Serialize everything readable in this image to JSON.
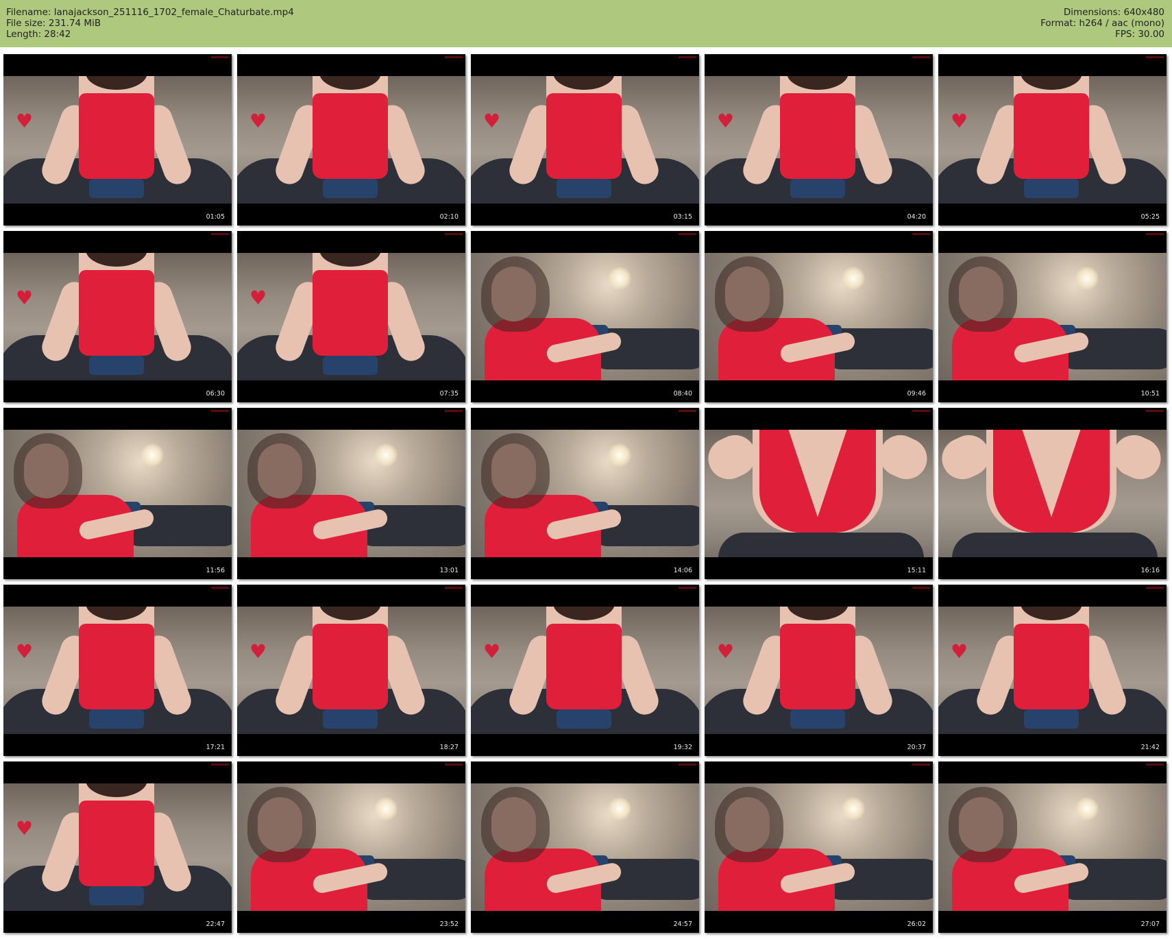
{
  "header": {
    "filename": "Filename: lanajackson_251116_1702_female_Chaturbate.mp4",
    "filesize": "File size: 231.74 MiB",
    "length": "Length: 28:42",
    "dimensions": "Dimensions: 640x480",
    "format": "Format: h264 / aac (mono)",
    "fps": "FPS: 30.00"
  },
  "thumbnails": [
    {
      "timestamp": "01:05",
      "scene": "sitting"
    },
    {
      "timestamp": "02:10",
      "scene": "sitting"
    },
    {
      "timestamp": "03:15",
      "scene": "sitting"
    },
    {
      "timestamp": "04:20",
      "scene": "sitting"
    },
    {
      "timestamp": "05:25",
      "scene": "sitting"
    },
    {
      "timestamp": "06:30",
      "scene": "sitting"
    },
    {
      "timestamp": "07:35",
      "scene": "sitting"
    },
    {
      "timestamp": "08:40",
      "scene": "reclining"
    },
    {
      "timestamp": "09:46",
      "scene": "reclining"
    },
    {
      "timestamp": "10:51",
      "scene": "reclining"
    },
    {
      "timestamp": "11:56",
      "scene": "reclining"
    },
    {
      "timestamp": "13:01",
      "scene": "reclining"
    },
    {
      "timestamp": "14:06",
      "scene": "reclining"
    },
    {
      "timestamp": "15:11",
      "scene": "closeup"
    },
    {
      "timestamp": "16:16",
      "scene": "closeup"
    },
    {
      "timestamp": "17:21",
      "scene": "sitting"
    },
    {
      "timestamp": "18:27",
      "scene": "sitting"
    },
    {
      "timestamp": "19:32",
      "scene": "sitting"
    },
    {
      "timestamp": "20:37",
      "scene": "sitting"
    },
    {
      "timestamp": "21:42",
      "scene": "sitting"
    },
    {
      "timestamp": "22:47",
      "scene": "sitting"
    },
    {
      "timestamp": "23:52",
      "scene": "reclining"
    },
    {
      "timestamp": "24:57",
      "scene": "reclining"
    },
    {
      "timestamp": "26:02",
      "scene": "reclining"
    },
    {
      "timestamp": "27:07",
      "scene": "reclining"
    }
  ],
  "colors": {
    "header_bg": "#aec87d",
    "top_red": "#e0203a",
    "timestamp_text": "#e8e8e8"
  }
}
